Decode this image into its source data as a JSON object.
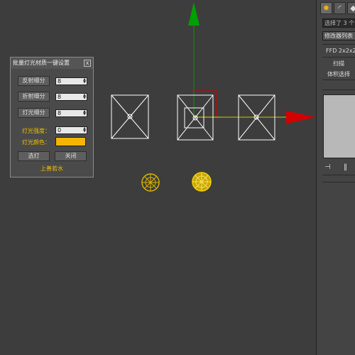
{
  "dialog": {
    "title": "批量灯光材质一键设置",
    "close_label": "x",
    "reflect_label": "反射细分",
    "reflect_value": "8",
    "refract_label": "折射细分",
    "refract_value": "8",
    "light_subdiv_label": "灯光细分",
    "light_subdiv_value": "8",
    "light_intensity_label": "灯光强度：",
    "light_intensity_value": "0",
    "light_color_label": "灯光颜色：",
    "light_color": "#f2b600",
    "select_label": "选灯",
    "close_button_label": "关闭",
    "credit": "上善若水"
  },
  "command_panel": {
    "tabs": [
      {
        "icon": "sun-icon",
        "glyph": "✸"
      },
      {
        "icon": "curve-icon",
        "glyph": "◜"
      },
      {
        "icon": "hierarchy-icon",
        "glyph": "◆"
      }
    ],
    "selection_text": "选择了 3 个",
    "modifier_list": "修改器列表",
    "stack": [
      "FFD 2x2x2",
      "扫描",
      "体积选择"
    ],
    "bottom_icons": [
      {
        "icon": "pin-stack-icon",
        "glyph": "⊣"
      },
      {
        "icon": "show-end-result-icon",
        "glyph": "‖"
      }
    ]
  },
  "viewport": {
    "gizmo_colors": {
      "x_axis": "#d40000",
      "y_axis": "#00a000",
      "z_highlight": "#e0e000",
      "selection": "#ffffff"
    }
  }
}
